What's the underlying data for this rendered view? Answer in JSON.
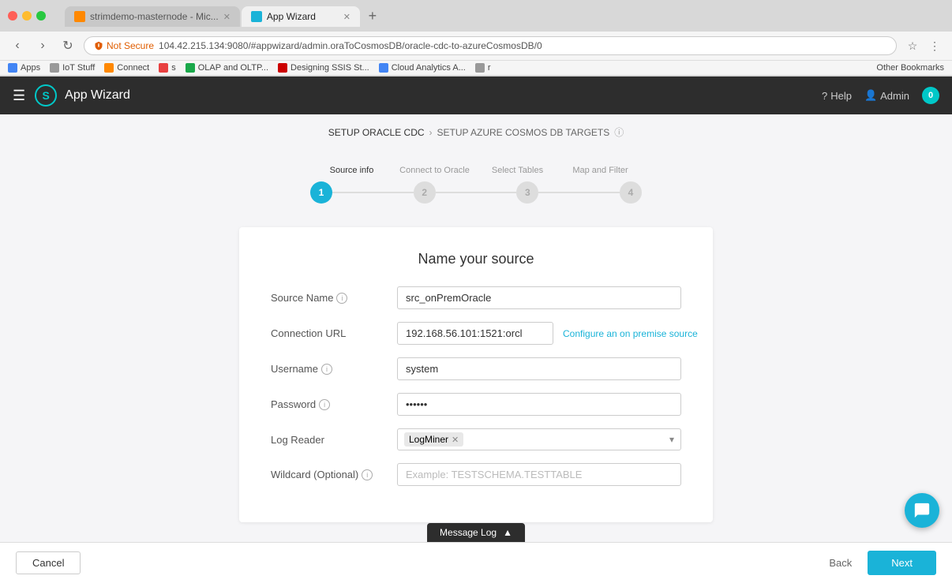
{
  "browser": {
    "tabs": [
      {
        "id": "tab1",
        "label": "strimdemo-masternode - Mic...",
        "active": false,
        "favicon": "S"
      },
      {
        "id": "tab2",
        "label": "App Wizard",
        "active": true,
        "favicon": "A"
      }
    ],
    "address": "104.42.215.134:9080/#appwizard/admin.oraToCosmosDB/oracle-cdc-to-azureCosmosDB/0",
    "security_label": "Not Secure",
    "bookmarks": [
      "Apps",
      "IoT Stuff",
      "Connect",
      "s",
      "OLAP and OLTP...",
      "Designing SSIS St...",
      "Cloud Analytics A...",
      "r"
    ],
    "other_bookmarks": "Other Bookmarks"
  },
  "header": {
    "app_title": "App Wizard",
    "help_label": "Help",
    "admin_label": "Admin",
    "notification_count": "0"
  },
  "breadcrumb": {
    "step1": "SETUP ORACLE CDC",
    "arrow": "›",
    "step2": "SETUP AZURE COSMOS DB TARGETS"
  },
  "steps": {
    "labels": [
      "Source info",
      "Connect to Oracle",
      "Select Tables",
      "Map and Filter"
    ],
    "active": 1
  },
  "form": {
    "title": "Name your source",
    "fields": {
      "source_name": {
        "label": "Source Name",
        "value": "src_onPremOracle",
        "has_info": true
      },
      "connection_url": {
        "label": "Connection URL",
        "value": "192.168.56.101:1521:orcl",
        "has_info": false,
        "link": "Configure an on premise source"
      },
      "username": {
        "label": "Username",
        "value": "system",
        "has_info": true
      },
      "password": {
        "label": "Password",
        "value": "••••••",
        "has_info": true
      },
      "log_reader": {
        "label": "Log Reader",
        "value": "LogMiner"
      },
      "wildcard": {
        "label": "Wildcard (Optional)",
        "placeholder": "Example: TESTSCHEMA.TESTTABLE",
        "has_info": true
      }
    }
  },
  "footer": {
    "cancel_label": "Cancel",
    "back_label": "Back",
    "next_label": "Next"
  },
  "message_log": {
    "label": "Message Log",
    "icon": "▲"
  }
}
